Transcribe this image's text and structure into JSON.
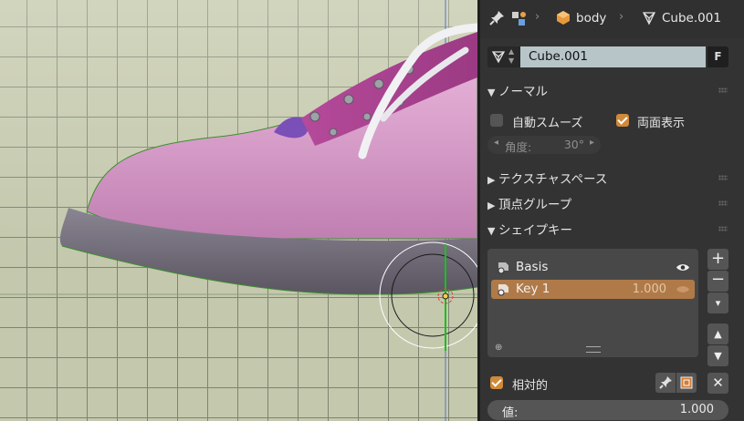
{
  "breadcrumb": {
    "object": "body",
    "mesh": "Cube.001"
  },
  "mesh_name": {
    "value": "Cube.001",
    "fake_user_label": "F"
  },
  "sections": {
    "normals": "ノーマル",
    "texture_space": "テクスチャスペース",
    "vertex_groups": "頂点グループ",
    "shape_keys": "シェイプキー"
  },
  "normals": {
    "auto_smooth_label": "自動スムーズ",
    "auto_smooth_checked": false,
    "double_sided_label": "両面表示",
    "double_sided_checked": true,
    "angle_label": "角度:",
    "angle_value": "30°"
  },
  "shape_keys": {
    "items": [
      {
        "name": "Basis",
        "value": "",
        "selected": false
      },
      {
        "name": "Key 1",
        "value": "1.000",
        "selected": true
      }
    ],
    "relative_label": "相対的",
    "relative_checked": true,
    "value_label": "値:",
    "value": "1.000"
  },
  "colors": {
    "accent": "#d08a3a",
    "selected_row": "#b07a48",
    "name_field": "#b7c5c9"
  }
}
